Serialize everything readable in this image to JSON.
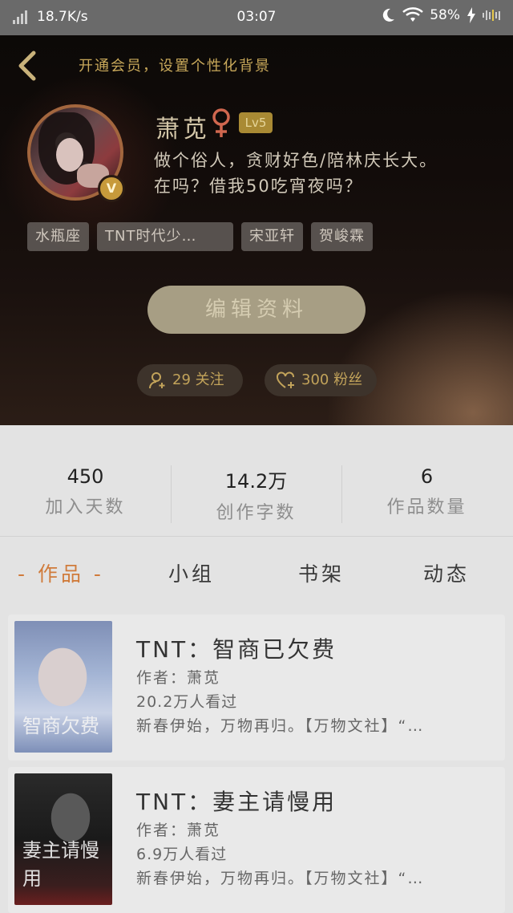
{
  "status_bar": {
    "net_speed": "18.7K/s",
    "time": "03:07",
    "battery": "58%"
  },
  "header": {
    "vip_link": "开通会员，设置个性化背景",
    "nickname": "萧苋",
    "level": "Lv5",
    "verified_badge": "V",
    "bio_line1": "做个俗人，贪财好色/陪林庆长大。",
    "bio_line2": "在吗？借我50吃宵夜吗？",
    "tags": [
      "水瓶座",
      "TNT时代少…",
      "宋亚轩",
      "贺峻霖"
    ],
    "edit_label": "编辑资料",
    "follow_label": "29 关注",
    "fans_label": "300 粉丝"
  },
  "stats": [
    {
      "value": "450",
      "label": "加入天数"
    },
    {
      "value": "14.2万",
      "label": "创作字数"
    },
    {
      "value": "6",
      "label": "作品数量"
    }
  ],
  "tabs": [
    "- 作品 -",
    "小组",
    "书架",
    "动态"
  ],
  "works": [
    {
      "title": "TNT：智商已欠费",
      "author": "作者：萧苋",
      "views": "20.2万人看过",
      "desc": "新春伊始，万物再归。【万物文社】“…",
      "cover_text": "智商欠费"
    },
    {
      "title": "TNT：妻主请慢用",
      "author": "作者：萧苋",
      "views": "6.9万人看过",
      "desc": "新春伊始，万物再归。【万物文社】“…",
      "cover_text": "妻主请慢用"
    }
  ],
  "colors": {
    "accent": "#d07b3b",
    "gold": "#c2a35a"
  }
}
